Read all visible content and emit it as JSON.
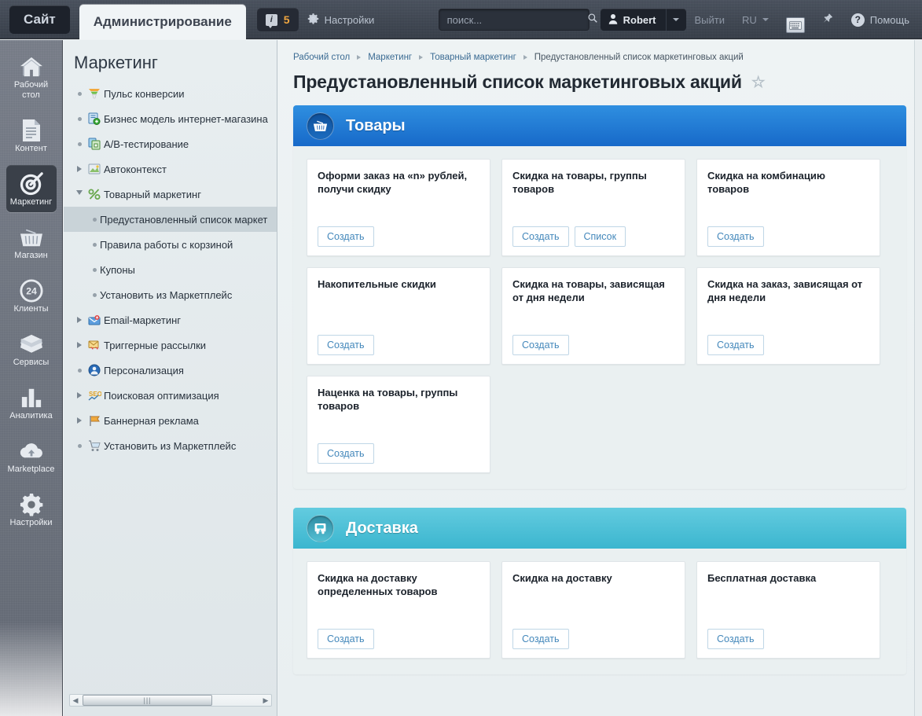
{
  "topbar": {
    "tabs": [
      {
        "label": "Сайт",
        "active": false
      },
      {
        "label": "Администрирование",
        "active": true
      }
    ],
    "counter": {
      "icon": "info-icon",
      "value": "5"
    },
    "settings_label": "Настройки",
    "search": {
      "value": "",
      "placeholder": "поиск...",
      "icon": "search-icon"
    },
    "user": {
      "name": "Robert",
      "icon": "user-icon",
      "arrow": "chevron-down-icon"
    },
    "logout_label": "Выйти",
    "language_label": "RU",
    "keyboard_icon": "keyboard-icon",
    "pin_icon": "pin-icon",
    "help_label": "Помощь",
    "help_icon": "question-mark-icon"
  },
  "rail": {
    "items": [
      {
        "label": "Рабочий стол",
        "icon": "home-icon",
        "active": false
      },
      {
        "label": "Контент",
        "icon": "document-icon",
        "active": false
      },
      {
        "label": "Маркетинг",
        "icon": "target-icon",
        "active": true
      },
      {
        "label": "Магазин",
        "icon": "basket-icon",
        "active": false
      },
      {
        "label": "Клиенты",
        "icon": "clock24-icon",
        "active": false
      },
      {
        "label": "Сервисы",
        "icon": "layers-icon",
        "active": false
      },
      {
        "label": "Аналитика",
        "icon": "bar-chart-icon",
        "active": false
      },
      {
        "label": "Marketplace",
        "icon": "cloud-download-icon",
        "active": false
      },
      {
        "label": "Настройки",
        "icon": "gear-icon",
        "active": false
      }
    ]
  },
  "tree": {
    "title": "Маркетинг",
    "items": [
      {
        "label": "Пульс конверсии",
        "icon": "funnel-icon",
        "twisty": "dot",
        "level": 0,
        "selected": false
      },
      {
        "label": "Бизнес модель интернет-магазина",
        "icon": "business-model-icon",
        "twisty": "dot",
        "level": 0,
        "selected": false
      },
      {
        "label": "A/B-тестирование",
        "icon": "ab-test-icon",
        "twisty": "dot",
        "level": 0,
        "selected": false
      },
      {
        "label": "Автоконтекст",
        "icon": "autocontext-icon",
        "twisty": "collapsed",
        "level": 0,
        "selected": false
      },
      {
        "label": "Товарный маркетинг",
        "icon": "percent-icon",
        "twisty": "expanded",
        "level": 0,
        "selected": false
      },
      {
        "label": "Предустановленный список маркет",
        "icon": "",
        "twisty": "dot",
        "level": 1,
        "selected": true
      },
      {
        "label": "Правила работы с корзиной",
        "icon": "",
        "twisty": "dot",
        "level": 1,
        "selected": false
      },
      {
        "label": "Купоны",
        "icon": "",
        "twisty": "dot",
        "level": 1,
        "selected": false
      },
      {
        "label": "Установить из Маркетплейс",
        "icon": "",
        "twisty": "dot",
        "level": 1,
        "selected": false
      },
      {
        "label": "Email-маркетинг",
        "icon": "email-marketing-icon",
        "twisty": "collapsed",
        "level": 0,
        "selected": false
      },
      {
        "label": "Триггерные рассылки",
        "icon": "trigger-mail-icon",
        "twisty": "collapsed",
        "level": 0,
        "selected": false
      },
      {
        "label": "Персонализация",
        "icon": "personalization-icon",
        "twisty": "dot",
        "level": 0,
        "selected": false
      },
      {
        "label": "Поисковая оптимизация",
        "icon": "seo-icon",
        "twisty": "collapsed",
        "level": 0,
        "selected": false
      },
      {
        "label": "Баннерная реклама",
        "icon": "banner-ad-icon",
        "twisty": "collapsed",
        "level": 0,
        "selected": false
      },
      {
        "label": "Установить из Маркетплейс",
        "icon": "marketplace-cart-icon",
        "twisty": "dot",
        "level": 0,
        "selected": false
      }
    ],
    "scrollbar": {
      "left_arrow": "◀",
      "right_arrow": "▶",
      "grip": "|||"
    }
  },
  "content": {
    "breadcrumb": [
      "Рабочий стол",
      "Маркетинг",
      "Товарный маркетинг",
      "Предустановленный список маркетинговых акций"
    ],
    "title": "Предустановленный список маркетинговых акций",
    "favorite_icon": "star-outline-icon",
    "colors": {
      "products_header": "#1f79d4",
      "delivery_header": "#49bcd2",
      "link": "#4488bb"
    },
    "sections": [
      {
        "title": "Товары",
        "icon": "basket-icon",
        "theme": "blue",
        "cards": [
          {
            "title": "Оформи заказ на «n» рублей, получи скидку",
            "buttons": [
              "Создать"
            ]
          },
          {
            "title": "Скидка на товары, группы товаров",
            "buttons": [
              "Создать",
              "Список"
            ]
          },
          {
            "title": "Скидка на комбинацию товаров",
            "buttons": [
              "Создать"
            ]
          },
          {
            "title": "Накопительные скидки",
            "buttons": [
              "Создать"
            ]
          },
          {
            "title": "Скидка на товары, зависящая от дня недели",
            "buttons": [
              "Создать"
            ]
          },
          {
            "title": "Скидка на заказ, зависящая от дня недели",
            "buttons": [
              "Создать"
            ]
          },
          {
            "title": "Наценка на товары, группы товаров",
            "buttons": [
              "Создать"
            ]
          }
        ]
      },
      {
        "title": "Доставка",
        "icon": "truck-icon",
        "theme": "cyan",
        "cards": [
          {
            "title": "Скидка на доставку определенных товаров",
            "buttons": [
              "Создать"
            ]
          },
          {
            "title": "Скидка на доставку",
            "buttons": [
              "Создать"
            ]
          },
          {
            "title": "Бесплатная доставка",
            "buttons": [
              "Создать"
            ]
          }
        ]
      }
    ]
  }
}
